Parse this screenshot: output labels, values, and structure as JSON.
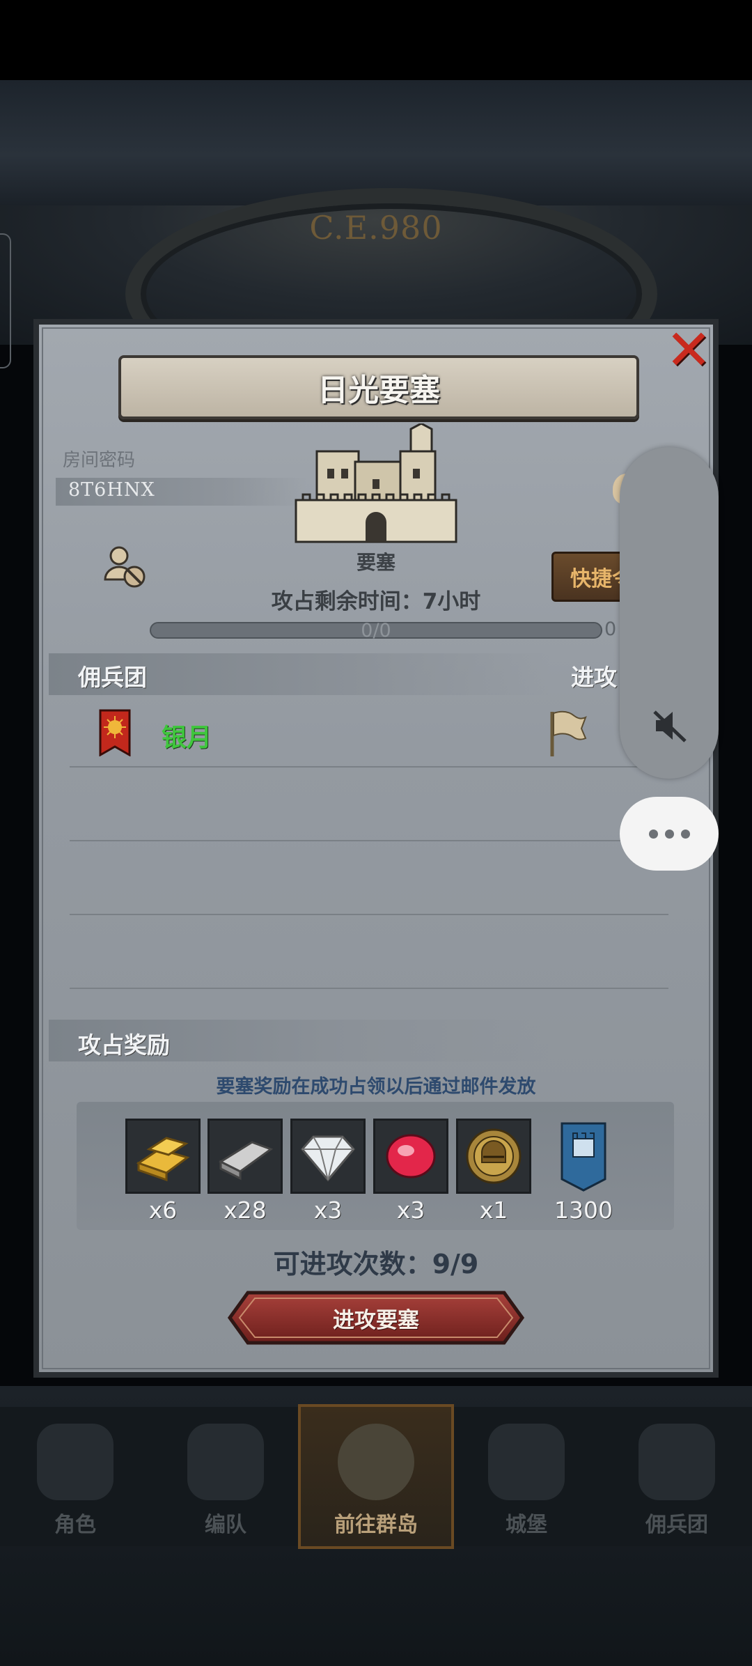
{
  "header": {
    "era": "C.E.980"
  },
  "panel": {
    "title": "日光要塞",
    "room_code_label": "房间密码",
    "room_code": "8T6HNX",
    "building_label": "要塞",
    "time_left": "攻占剩余时间：7小时",
    "progress_text": "0/0",
    "progress_right": "0",
    "quick_button": "快捷令",
    "mercenary_section": "佣兵团",
    "attack_column": "进攻",
    "guild": {
      "name": "银月"
    },
    "reward_section": "攻占奖励",
    "reward_note": "要塞奖励在成功占领以后通过邮件发放",
    "rewards": [
      {
        "icon": "gold-bar-icon",
        "qty": "x6"
      },
      {
        "icon": "iron-bar-icon",
        "qty": "x28"
      },
      {
        "icon": "diamond-icon",
        "qty": "x3"
      },
      {
        "icon": "ruby-icon",
        "qty": "x3"
      },
      {
        "icon": "helmet-medal-icon",
        "qty": "x1"
      },
      {
        "icon": "banner-token-icon",
        "qty": "1300"
      }
    ],
    "attempts": "可进攻次数：9/9",
    "attack_button": "进攻要塞"
  },
  "navbar": {
    "items": [
      {
        "label": "角色"
      },
      {
        "label": "编队"
      },
      {
        "label": "前往群岛"
      },
      {
        "label": "城堡"
      },
      {
        "label": "佣兵团"
      }
    ],
    "active": "前往群岛"
  },
  "colors": {
    "guild_name": "#3fc63d",
    "close": "#c92a1e",
    "attack_button": "#8a2a26",
    "reward_note": "#2e4a6e"
  }
}
